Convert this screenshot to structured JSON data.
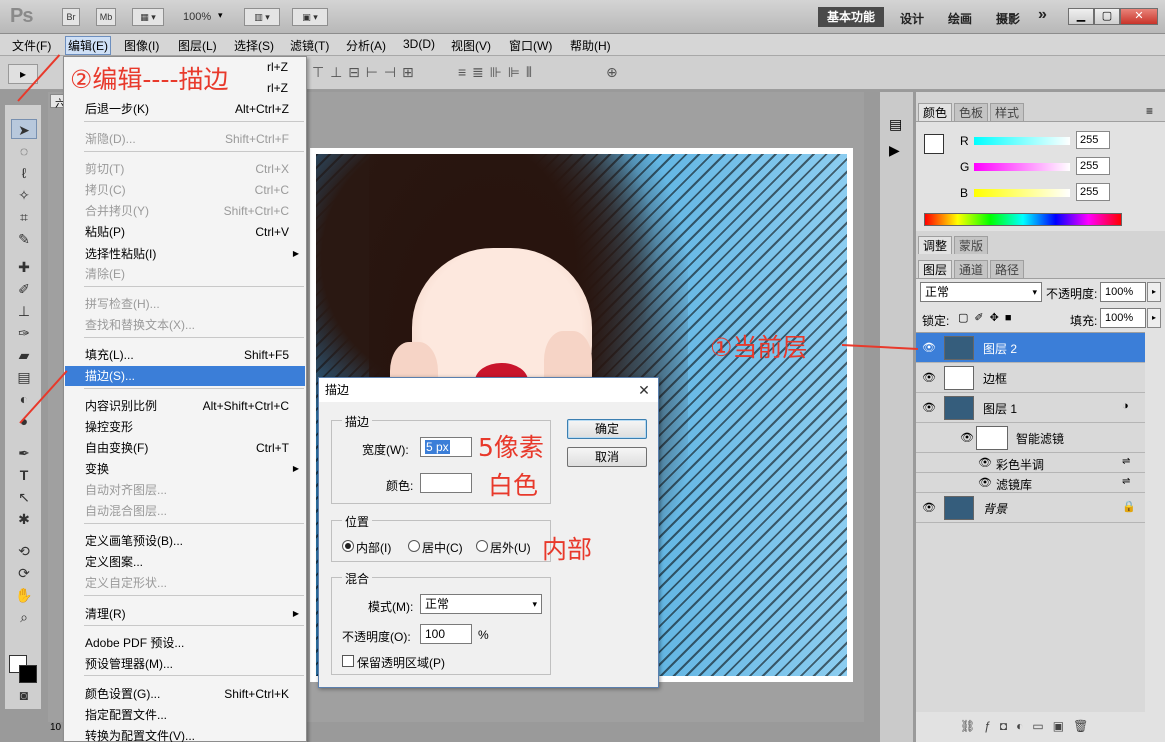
{
  "app": {
    "logo": "Ps",
    "zoom": "100%"
  },
  "titlebar": {
    "br": "Br",
    "mb": "Mb",
    "workspaces": [
      "基本功能",
      "设计",
      "绘画",
      "摄影"
    ],
    "more": "»"
  },
  "menubar": [
    "文件(F)",
    "编辑(E)",
    "图像(I)",
    "图层(L)",
    "选择(S)",
    "滤镜(T)",
    "分析(A)",
    "3D(D)",
    "视图(V)",
    "窗口(W)",
    "帮助(H)"
  ],
  "doc_tab": {
    "label": "六",
    "zoom": "10"
  },
  "edit_menu": {
    "items": [
      {
        "label": "后退一步(K)",
        "shortcut": "Alt+Ctrl+Z",
        "state": "normal"
      },
      {
        "label": "渐隐(D)...",
        "shortcut": "Shift+Ctrl+F",
        "state": "disabled"
      },
      {
        "label": "剪切(T)",
        "shortcut": "Ctrl+X",
        "state": "disabled"
      },
      {
        "label": "拷贝(C)",
        "shortcut": "Ctrl+C",
        "state": "disabled"
      },
      {
        "label": "合并拷贝(Y)",
        "shortcut": "Shift+Ctrl+C",
        "state": "disabled"
      },
      {
        "label": "粘贴(P)",
        "shortcut": "Ctrl+V",
        "state": "normal"
      },
      {
        "label": "选择性粘贴(I)",
        "shortcut": "",
        "state": "submenu"
      },
      {
        "label": "清除(E)",
        "shortcut": "",
        "state": "disabled"
      },
      {
        "label": "拼写检查(H)...",
        "shortcut": "",
        "state": "disabled"
      },
      {
        "label": "查找和替换文本(X)...",
        "shortcut": "",
        "state": "disabled"
      },
      {
        "label": "填充(L)...",
        "shortcut": "Shift+F5",
        "state": "normal"
      },
      {
        "label": "描边(S)...",
        "shortcut": "",
        "state": "selected"
      },
      {
        "label": "内容识别比例",
        "shortcut": "Alt+Shift+Ctrl+C",
        "state": "normal"
      },
      {
        "label": "操控变形",
        "shortcut": "",
        "state": "normal"
      },
      {
        "label": "自由变换(F)",
        "shortcut": "Ctrl+T",
        "state": "normal"
      },
      {
        "label": "变换",
        "shortcut": "",
        "state": "submenu"
      },
      {
        "label": "自动对齐图层...",
        "shortcut": "",
        "state": "disabled"
      },
      {
        "label": "自动混合图层...",
        "shortcut": "",
        "state": "disabled"
      },
      {
        "label": "定义画笔预设(B)...",
        "shortcut": "",
        "state": "normal"
      },
      {
        "label": "定义图案...",
        "shortcut": "",
        "state": "normal"
      },
      {
        "label": "定义自定形状...",
        "shortcut": "",
        "state": "disabled"
      },
      {
        "label": "清理(R)",
        "shortcut": "",
        "state": "submenu"
      },
      {
        "label": "Adobe PDF 预设...",
        "shortcut": "",
        "state": "normal"
      },
      {
        "label": "预设管理器(M)...",
        "shortcut": "",
        "state": "normal"
      },
      {
        "label": "颜色设置(G)...",
        "shortcut": "Shift+Ctrl+K",
        "state": "normal"
      },
      {
        "label": "指定配置文件...",
        "shortcut": "",
        "state": "normal"
      },
      {
        "label": "转换为配置文件(V)...",
        "shortcut": "",
        "state": "normal"
      }
    ],
    "partial_shortcuts": [
      "rl+Z",
      "rl+Z"
    ]
  },
  "stroke_dialog": {
    "title": "描边",
    "stroke_group": "描边",
    "width_label": "宽度(W):",
    "width_value": "5 px",
    "color_label": "颜色:",
    "ok": "确定",
    "cancel": "取消",
    "location_group": "位置",
    "inside": "内部(I)",
    "center": "居中(C)",
    "outside": "居外(U)",
    "blend_group": "混合",
    "mode_label": "模式(M):",
    "mode_value": "正常",
    "opacity_label": "不透明度(O):",
    "opacity_value": "100",
    "opacity_unit": "%",
    "preserve": "保留透明区域(P)"
  },
  "color_panel": {
    "tabs": [
      "颜色",
      "色板",
      "样式"
    ],
    "r_label": "R",
    "g_label": "G",
    "b_label": "B",
    "r": "255",
    "g": "255",
    "b": "255"
  },
  "adjust_panel": {
    "tabs": [
      "调整",
      "蒙版"
    ]
  },
  "layers_panel": {
    "tabs": [
      "图层",
      "通道",
      "路径"
    ],
    "blend_mode": "正常",
    "opacity_label": "不透明度:",
    "opacity": "100%",
    "lock_label": "锁定:",
    "fill_label": "填充:",
    "fill": "100%",
    "layers": [
      {
        "name": "图层 2",
        "selected": true
      },
      {
        "name": "边框",
        "selected": false
      },
      {
        "name": "图层 1",
        "selected": false
      },
      {
        "name": "智能滤镜",
        "selected": false
      },
      {
        "name": "彩色半调",
        "selected": false
      },
      {
        "name": "滤镜库",
        "selected": false
      },
      {
        "name": "背景",
        "selected": false
      }
    ]
  },
  "annotations": {
    "step2": "②编辑----描边",
    "width_note": "5像素",
    "color_note": "白色",
    "position_note": "内部",
    "step1": "①当前层"
  },
  "colors": {
    "accent": "#3b7ed8",
    "annotation": "#e8392b"
  }
}
